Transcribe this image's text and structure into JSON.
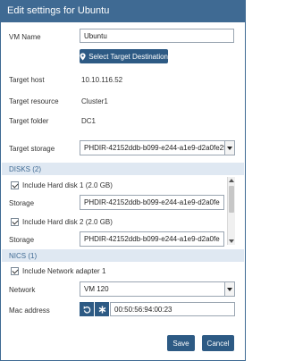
{
  "dialog": {
    "title": "Edit settings for Ubuntu"
  },
  "vm_name": {
    "label": "VM Name",
    "value": "Ubuntu"
  },
  "select_target_button": "Select Target Destination",
  "target_host": {
    "label": "Target host",
    "value": "10.10.116.52"
  },
  "target_resource": {
    "label": "Target resource",
    "value": "Cluster1"
  },
  "target_folder": {
    "label": "Target folder",
    "value": "DC1"
  },
  "target_storage": {
    "label": "Target storage",
    "value": "PHDIR-42152ddb-b099-e244-a1e9-d2a0fe2fa"
  },
  "disks": {
    "header": "DISKS (2)",
    "items": [
      {
        "checked": true,
        "label": "Include Hard disk 1 (2.0 GB)",
        "storage_label": "Storage",
        "storage_value": "PHDIR-42152ddb-b099-e244-a1e9-d2a0fe"
      },
      {
        "checked": true,
        "label": "Include Hard disk 2 (2.0 GB)",
        "storage_label": "Storage",
        "storage_value": "PHDIR-42152ddb-b099-e244-a1e9-d2a0fe"
      }
    ]
  },
  "nics": {
    "header": "NICS (1)",
    "adapter": {
      "checked": true,
      "label": "Include Network adapter 1"
    },
    "network": {
      "label": "Network",
      "value": "VM 120"
    },
    "mac": {
      "label": "Mac address",
      "value": "00:50:56:94:00:23"
    }
  },
  "footer": {
    "save": "Save",
    "cancel": "Cancel"
  },
  "colors": {
    "title_bar": "#3f6a93",
    "button": "#2d5a84",
    "section_header": "#dfe8f2"
  },
  "icons": {
    "location": "map-pin-icon",
    "reset": "undo-icon",
    "generate": "asterisk-icon"
  }
}
